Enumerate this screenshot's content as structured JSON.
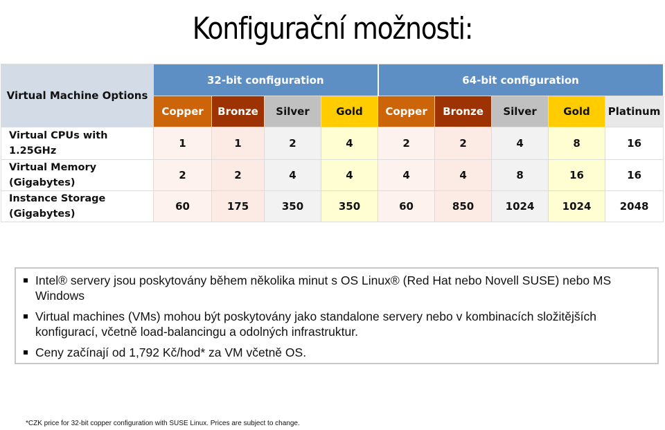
{
  "title": "Konfigurační možnosti:",
  "table": {
    "corner_label": "Virtual Machine Options",
    "groups": [
      {
        "label": "32-bit configuration",
        "span": 4
      },
      {
        "label": "64-bit configuration",
        "span": 5
      }
    ],
    "tiers": [
      "Copper",
      "Bronze",
      "Silver",
      "Gold",
      "Copper",
      "Bronze",
      "Silver",
      "Gold",
      "Platinum"
    ],
    "tier_colors": {
      "Copper": "#cc650a",
      "Bronze": "#9d3303",
      "Silver": "#c0c0c0",
      "Gold": "#ffcc00",
      "Platinum": "#e8e8e8"
    },
    "rows": [
      {
        "label": "Virtual CPUs with 1.25GHz",
        "values": [
          "1",
          "1",
          "2",
          "4",
          "2",
          "2",
          "4",
          "8",
          "16"
        ]
      },
      {
        "label": "Virtual Memory (Gigabytes)",
        "values": [
          "2",
          "2",
          "4",
          "4",
          "4",
          "4",
          "8",
          "16",
          "16"
        ]
      },
      {
        "label": "Instance Storage (Gigabytes)",
        "values": [
          "60",
          "175",
          "350",
          "350",
          "60",
          "850",
          "1024",
          "1024",
          "2048"
        ]
      }
    ]
  },
  "bullets": [
    "Intel® servery jsou poskytovány během několika minut s OS Linux® (Red Hat nebo Novell SUSE) nebo MS Windows",
    "Virtual machines (VMs) mohou být poskytovány jako standalone servery nebo v kombinacích složitějších konfigurací, včetně load-balancingu a odolných infrastruktur.",
    "Ceny začínají od 1,792 Kč/hod* za VM včetně OS."
  ],
  "footnote": "*CZK price for 32-bit copper configuration with SUSE Linux. Prices are subject to change."
}
